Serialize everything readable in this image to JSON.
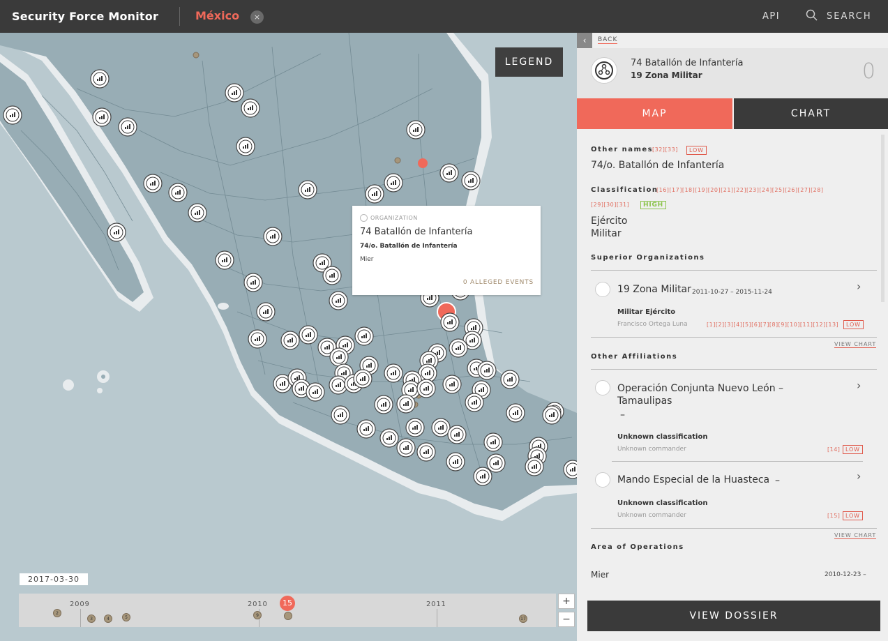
{
  "header": {
    "brand": "Security Force Monitor",
    "country": "México",
    "close_glyph": "×",
    "api_label": "API",
    "search_label": "SEARCH"
  },
  "map": {
    "legend_label": "LEGEND",
    "popup": {
      "type_label": "ORGANIZATION",
      "title": "74 Batallón de Infantería",
      "alt_name": "74/o. Batallón de Infantería",
      "location": "Mier",
      "events": "0 ALLEGED EVENTS"
    },
    "date": "2017-03-30",
    "timeline": {
      "years": [
        "2009",
        "2010",
        "2011"
      ],
      "current_count": "15",
      "dots": [
        "2",
        "3",
        "4",
        "5",
        "9",
        "17"
      ],
      "zoom_in": "+",
      "zoom_out": "−"
    }
  },
  "panel": {
    "back_label": "BACK",
    "org": {
      "name": "74 Batallón de Infantería",
      "parent": "19 Zona Militar",
      "event_count": "0"
    },
    "tabs": {
      "map": "MAP",
      "chart": "CHART"
    },
    "other_names": {
      "label": "Other names",
      "refs": "[32][33]",
      "confidence": "LOW",
      "value": "74/o. Batallón de Infantería"
    },
    "classification": {
      "label": "Classification",
      "refs_line1": "[16][17][18][19][20][21][22][23][24][25][26][27][28]",
      "refs_line2": "[29][30][31]",
      "confidence": "HIGH",
      "value_1": "Ejército",
      "value_2": "Militar"
    },
    "superior": {
      "label": "Superior Organizations",
      "name": "19 Zona Militar",
      "dates": "2011-10-27  –  2015-11-24",
      "classification": "Militar  Ejército",
      "commander": "Francisco Ortega Luna",
      "refs": "[1][2][3][4][5][6][7][8][9][10][11][12][13]",
      "confidence": "LOW",
      "view_chart": "VIEW CHART"
    },
    "affiliations": {
      "label": "Other Affiliations",
      "items": [
        {
          "name_1": "Operación Conjunta Nuevo León –",
          "name_2": "Tamaulipas",
          "dash": "–",
          "classification": "Unknown classification",
          "commander": "Unknown commander",
          "refs": "[14]",
          "confidence": "LOW"
        },
        {
          "name_1": "Mando Especial de la Huasteca",
          "dash": "–",
          "classification": "Unknown classification",
          "commander": "Unknown commander",
          "refs": "[15]",
          "confidence": "LOW"
        }
      ],
      "view_chart": "VIEW CHART"
    },
    "area": {
      "label": "Area of Operations",
      "location": "Mier",
      "dates": "2010-12-23  –"
    },
    "dossier_label": "VIEW DOSSIER"
  },
  "colors": {
    "accent": "#f0695a",
    "header_bg": "#3a3a3a",
    "water": "#b9c9cf",
    "land": "#98adb5",
    "high": "#8bc34a"
  }
}
